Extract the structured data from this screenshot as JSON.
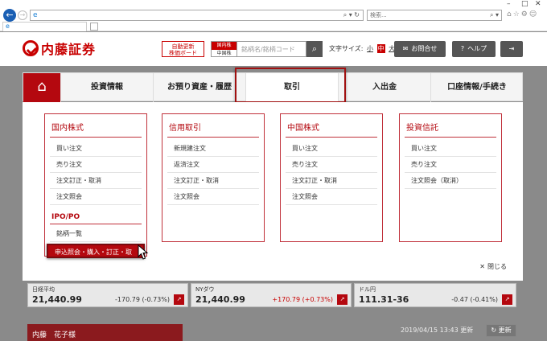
{
  "browser": {
    "window_controls": [
      "–",
      "□",
      "✕"
    ],
    "search_placeholder": "検索...",
    "url_controls": "⌕ ▾ ↻",
    "search_controls": "⌕ ▾",
    "right_icons": "⌂☆⚙☺"
  },
  "header": {
    "logo_text": "内藤証券",
    "board_button": "自動更新\n株価ボード",
    "stock_switch": {
      "on": "国内株",
      "off": "中国株"
    },
    "code_placeholder": "銘柄名/銘柄コード",
    "font_size_label": "文字サイズ:",
    "font_sizes": [
      "小",
      "中",
      "大"
    ],
    "contact_label": "お問合せ",
    "help_label": "ヘルプ",
    "logout_icon": "logout-icon"
  },
  "nav": {
    "home_icon": "home-icon",
    "items": [
      "投資情報",
      "お預り資産・履歴",
      "取引",
      "入出金",
      "口座情報/手続き"
    ],
    "active": "取引"
  },
  "dropdown": {
    "domestic": {
      "title": "国内株式",
      "items": [
        "買い注文",
        "売り注文",
        "注文訂正・取消",
        "注文照会"
      ],
      "ipo_title": "IPO/PO",
      "ipo_items": [
        "銘柄一覧",
        "申込照会・購入・訂正・取消"
      ]
    },
    "margin": {
      "title": "信用取引",
      "items": [
        "新規建注文",
        "返済注文",
        "注文訂正・取消",
        "注文照会"
      ]
    },
    "china": {
      "title": "中国株式",
      "items": [
        "買い注文",
        "売り注文",
        "注文訂正・取消",
        "注文照会"
      ]
    },
    "fund": {
      "title": "投資信託",
      "items": [
        "買い注文",
        "売り注文",
        "注文照会（取消）"
      ]
    },
    "close_label": "閉じる"
  },
  "market": [
    {
      "name": "日経平均",
      "value": "21,440.99",
      "change": "-170.79 (-0.73%)",
      "dir": "down"
    },
    {
      "name": "NYダウ",
      "value": "21,440.99",
      "change": "+170.79 (+0.73%)",
      "dir": "up"
    },
    {
      "name": "ドル円",
      "value": "111.31-36",
      "change": "-0.47 (-0.41%)",
      "dir": "down"
    }
  ],
  "user": {
    "name": "内藤　花子様"
  },
  "updated": "2019/04/15 13:43 更新",
  "refresh_label": "更新",
  "colors": {
    "brand": "#b4080f",
    "accent": "#c80000"
  }
}
